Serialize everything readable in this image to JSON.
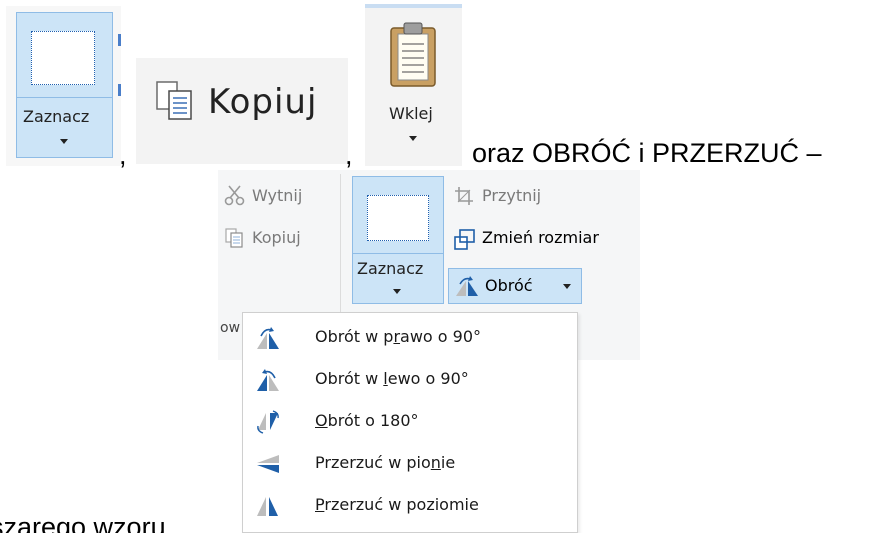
{
  "document": {
    "comma_1": ",",
    "comma_2": ",",
    "sentence_end": "oraz OBRÓĆ i PRZERZUĆ –",
    "bottom_fragment": "szarego wzoru"
  },
  "clip_select": {
    "label": "Zaznacz"
  },
  "clip_copy": {
    "label": "Kopiuj"
  },
  "clip_paste": {
    "label": "Wklej"
  },
  "ribbon": {
    "cut_label": "Wytnij",
    "copy_label": "Kopiuj",
    "select_label": "Zaznacz",
    "crop_label": "Przytnij",
    "resize_label": "Zmień rozmiar",
    "rotate_label": "Obróć",
    "group_fragment": "ow"
  },
  "rotate_menu": {
    "items": [
      {
        "pre": "Obrót w p",
        "u": "r",
        "post": "awo o 90°",
        "icon": "rotate-right-icon"
      },
      {
        "pre": "Obrót w ",
        "u": "l",
        "post": "ewo o 90°",
        "icon": "rotate-left-icon"
      },
      {
        "pre": "",
        "u": "O",
        "post": "brót o 180°",
        "icon": "rotate-180-icon"
      },
      {
        "pre": "Przerzuć w pio",
        "u": "n",
        "post": "ie",
        "icon": "flip-vertical-icon"
      },
      {
        "pre": "",
        "u": "P",
        "post": "rzerzuć w poziomie",
        "icon": "flip-horizontal-icon"
      }
    ]
  },
  "colors": {
    "selection_blue": "#cce4f7",
    "selection_border": "#8fbce6",
    "icon_blue": "#1f5fa8",
    "icon_gray": "#9a9a9a"
  }
}
